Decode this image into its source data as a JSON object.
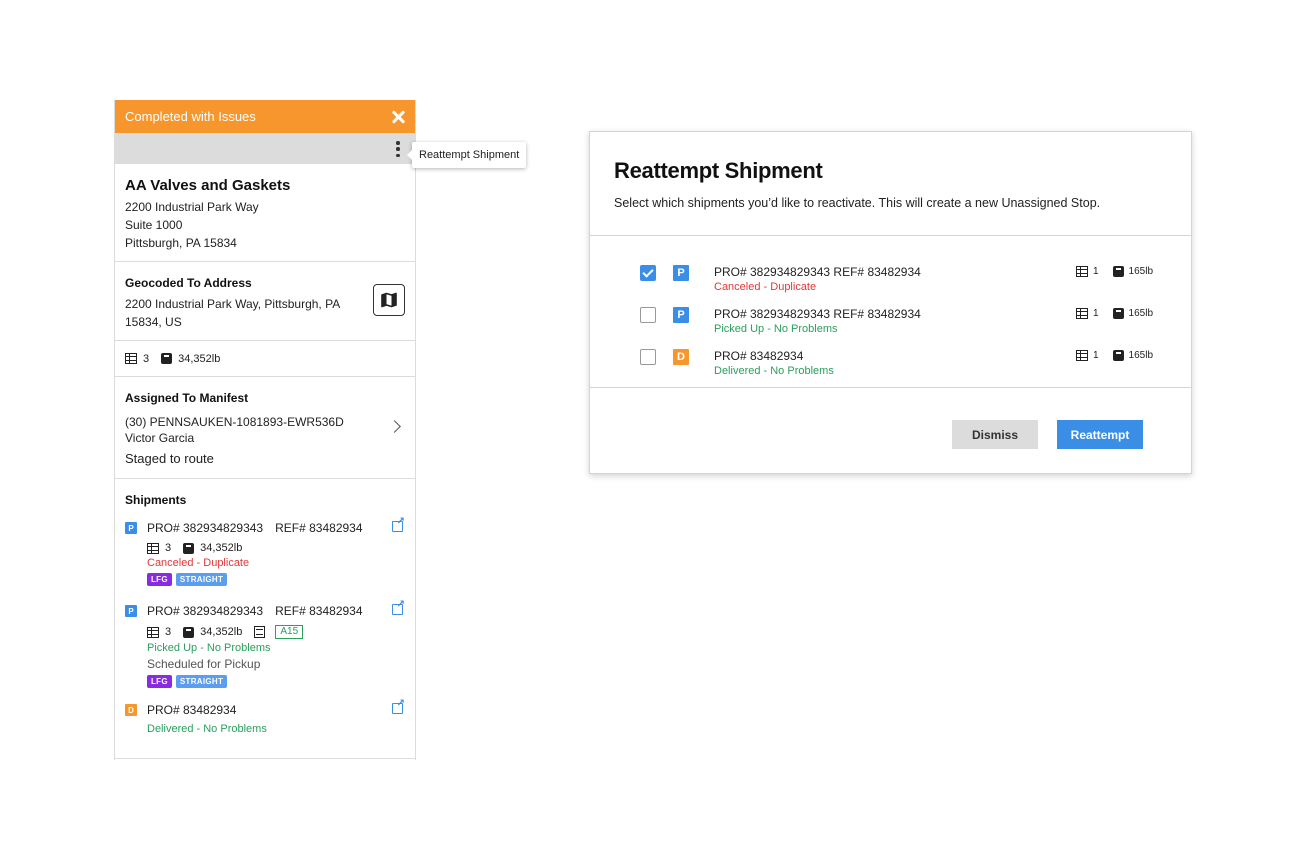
{
  "panel": {
    "header_title": "Completed with Issues",
    "company": {
      "name": "AA Valves and Gaskets",
      "address_lines": [
        "2200 Industrial Park Way",
        "Suite 1000",
        "Pittsburgh, PA 15834"
      ]
    },
    "geocoded": {
      "title": "Geocoded To Address",
      "text": "2200 Industrial Park Way, Pittsburgh, PA 15834, US"
    },
    "totals": {
      "pieces": "3",
      "weight": "34,352lb"
    },
    "manifest": {
      "title": "Assigned To Manifest",
      "name": "(30) PENNSAUKEN-1081893-EWR536D",
      "driver": "Victor Garcia",
      "status": "Staged to route"
    },
    "shipments_title": "Shipments",
    "shipments": [
      {
        "type": "P",
        "type_color": "#3a8ee6",
        "pro": "PRO# 382934829343",
        "ref": "REF# 83482934",
        "pieces": "3",
        "weight": "34,352lb",
        "status": "Canceled - Duplicate",
        "status_kind": "red",
        "tags": [
          "LFG",
          "STRAIGHT"
        ]
      },
      {
        "type": "P",
        "type_color": "#3a8ee6",
        "pro": "PRO# 382934829343",
        "ref": "REF# 83482934",
        "pieces": "3",
        "weight": "34,352lb",
        "location": "A15",
        "status": "Picked Up - No Problems",
        "status_kind": "green",
        "scheduled": "Scheduled for Pickup",
        "tags": [
          "LFG",
          "STRAIGHT"
        ]
      },
      {
        "type": "D",
        "type_color": "#f7962c",
        "pro": "PRO# 83482934",
        "status": "Delivered - No Problems",
        "status_kind": "green"
      }
    ],
    "tag_colors": {
      "LFG": "#8a2be2",
      "STRAIGHT": "#5b9ef0"
    }
  },
  "tooltip": {
    "text": "Reattempt Shipment"
  },
  "modal": {
    "title": "Reattempt Shipment",
    "subtitle": "Select which shipments you’d like to reactivate. This will create a new Unassigned Stop.",
    "rows": [
      {
        "checked": true,
        "type": "P",
        "type_color": "#3a8ee6",
        "text": "PRO# 382934829343 REF# 83482934",
        "status": "Canceled - Duplicate",
        "status_kind": "red",
        "pieces": "1",
        "weight": "165lb"
      },
      {
        "checked": false,
        "type": "P",
        "type_color": "#3a8ee6",
        "text": "PRO# 382934829343 REF# 83482934",
        "status": "Picked Up - No Problems",
        "status_kind": "green",
        "pieces": "1",
        "weight": "165lb"
      },
      {
        "checked": false,
        "type": "D",
        "type_color": "#f7962c",
        "text": "PRO# 83482934",
        "status": "Delivered - No Problems",
        "status_kind": "green",
        "pieces": "1",
        "weight": "165lb"
      }
    ],
    "dismiss_label": "Dismiss",
    "reattempt_label": "Reattempt"
  },
  "colors": {
    "header": "#f7962c",
    "accent": "#3a8ee6",
    "error": "#e03838",
    "success": "#2aa05b"
  }
}
